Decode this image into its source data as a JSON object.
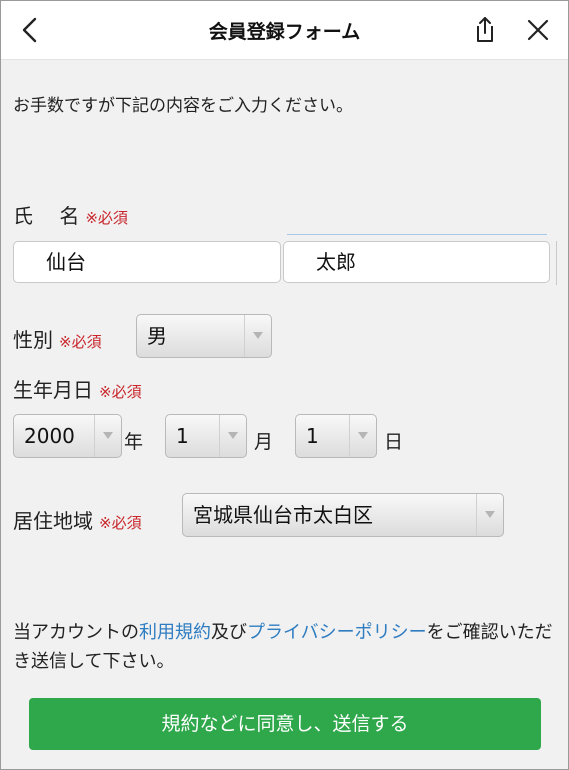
{
  "header": {
    "title": "会員登録フォーム",
    "back_icon": "chevron-left-icon",
    "share_icon": "share-icon",
    "close_icon": "close-icon"
  },
  "intro": "お手数ですが下記の内容をご入力ください。",
  "required_mark": "※必須",
  "name": {
    "label": "氏　 名",
    "last_name": "仙台",
    "first_name": "太郎"
  },
  "gender": {
    "label": "性別",
    "value": "男"
  },
  "birthdate": {
    "label": "生年月日",
    "year": "2000",
    "year_unit": "年",
    "month": "1",
    "month_unit": "月",
    "day": "1",
    "day_unit": "日"
  },
  "region": {
    "label": "居住地域",
    "value": "宮城県仙台市太白区"
  },
  "terms": {
    "prefix": "当アカウントの",
    "terms_link": "利用規約",
    "middle": "及び",
    "privacy_link": "プライバシーポリシー",
    "suffix": "をご確認いただき送信して下さい。"
  },
  "submit_label": "規約などに同意し、送信する",
  "colors": {
    "submit_green": "#2fa84b",
    "link_blue": "#2f7dc1",
    "required_red": "#c8262b"
  }
}
